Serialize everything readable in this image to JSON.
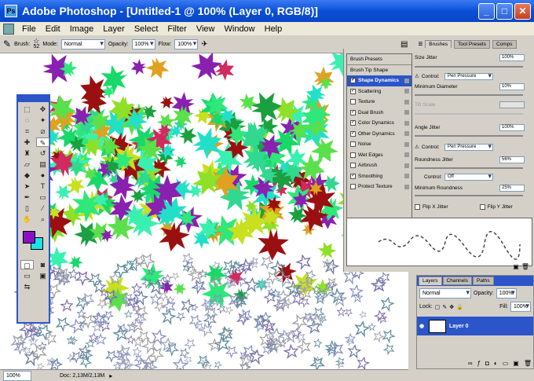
{
  "window": {
    "title": "Adobe Photoshop - [Untitled-1 @ 100% (Layer 0, RGB/8)]",
    "logo_text": "Ps",
    "minimize": "_",
    "maximize": "□",
    "close": "✕"
  },
  "menu": [
    "File",
    "Edit",
    "Image",
    "Layer",
    "Select",
    "Filter",
    "View",
    "Window",
    "Help"
  ],
  "options": {
    "brush_label": "Brush:",
    "brush_size": "52",
    "mode_label": "Mode:",
    "mode_value": "Normal",
    "opacity_label": "Opacity:",
    "opacity_value": "100%",
    "flow_label": "Flow:",
    "flow_value": "100%"
  },
  "status": {
    "zoom": "100%",
    "doc": "Doc: 2,13M/2,13M"
  },
  "palette_tabs": [
    "Brushes",
    "Tool Presets",
    "Comps"
  ],
  "brush_panel": {
    "items": [
      {
        "label": "Brush Presets",
        "checkbox": false,
        "checked": false,
        "selected": false
      },
      {
        "label": "Brush Tip Shape",
        "checkbox": false,
        "checked": false,
        "selected": false
      },
      {
        "label": "Shape Dynamics",
        "checkbox": true,
        "checked": true,
        "selected": true
      },
      {
        "label": "Scattering",
        "checkbox": true,
        "checked": true,
        "selected": false
      },
      {
        "label": "Texture",
        "checkbox": true,
        "checked": false,
        "selected": false
      },
      {
        "label": "Dual Brush",
        "checkbox": true,
        "checked": true,
        "selected": false
      },
      {
        "label": "Color Dynamics",
        "checkbox": true,
        "checked": true,
        "selected": false
      },
      {
        "label": "Other Dynamics",
        "checkbox": true,
        "checked": true,
        "selected": false
      },
      {
        "label": "Noise",
        "checkbox": true,
        "checked": false,
        "selected": false
      },
      {
        "label": "Wet Edges",
        "checkbox": true,
        "checked": false,
        "selected": false
      },
      {
        "label": "Airbrush",
        "checkbox": true,
        "checked": false,
        "selected": false
      },
      {
        "label": "Smoothing",
        "checkbox": true,
        "checked": true,
        "selected": false
      },
      {
        "label": "Protect Texture",
        "checkbox": true,
        "checked": false,
        "selected": false
      }
    ],
    "size_jitter_label": "Size Jitter",
    "size_jitter": "100%",
    "control_label": "Control:",
    "control_value": "Pen Pressure",
    "min_diameter_label": "Minimum Diameter",
    "min_diameter": "10%",
    "tilt_scale_label": "Tilt Scale",
    "angle_jitter_label": "Angle Jitter",
    "angle_jitter": "100%",
    "control2_value": "Pen Pressure",
    "roundness_jitter_label": "Roundness Jitter",
    "roundness_jitter": "56%",
    "control3_value": "Off",
    "min_roundness_label": "Minimum Roundness",
    "min_roundness": "25%",
    "flip_x_label": "Flip X Jitter",
    "flip_y_label": "Flip Y Jitter"
  },
  "layers": {
    "tabs": [
      "Layers",
      "Channels",
      "Paths"
    ],
    "blend_mode": "Normal",
    "opacity_label": "Opacity:",
    "opacity": "100%",
    "lock_label": "Lock:",
    "fill_label": "Fill:",
    "fill": "100%",
    "layer_name": "Layer 0"
  },
  "colors": {
    "foreground": "#8a10c8",
    "background": "#20e0e8",
    "accent": "#2b55c8"
  }
}
